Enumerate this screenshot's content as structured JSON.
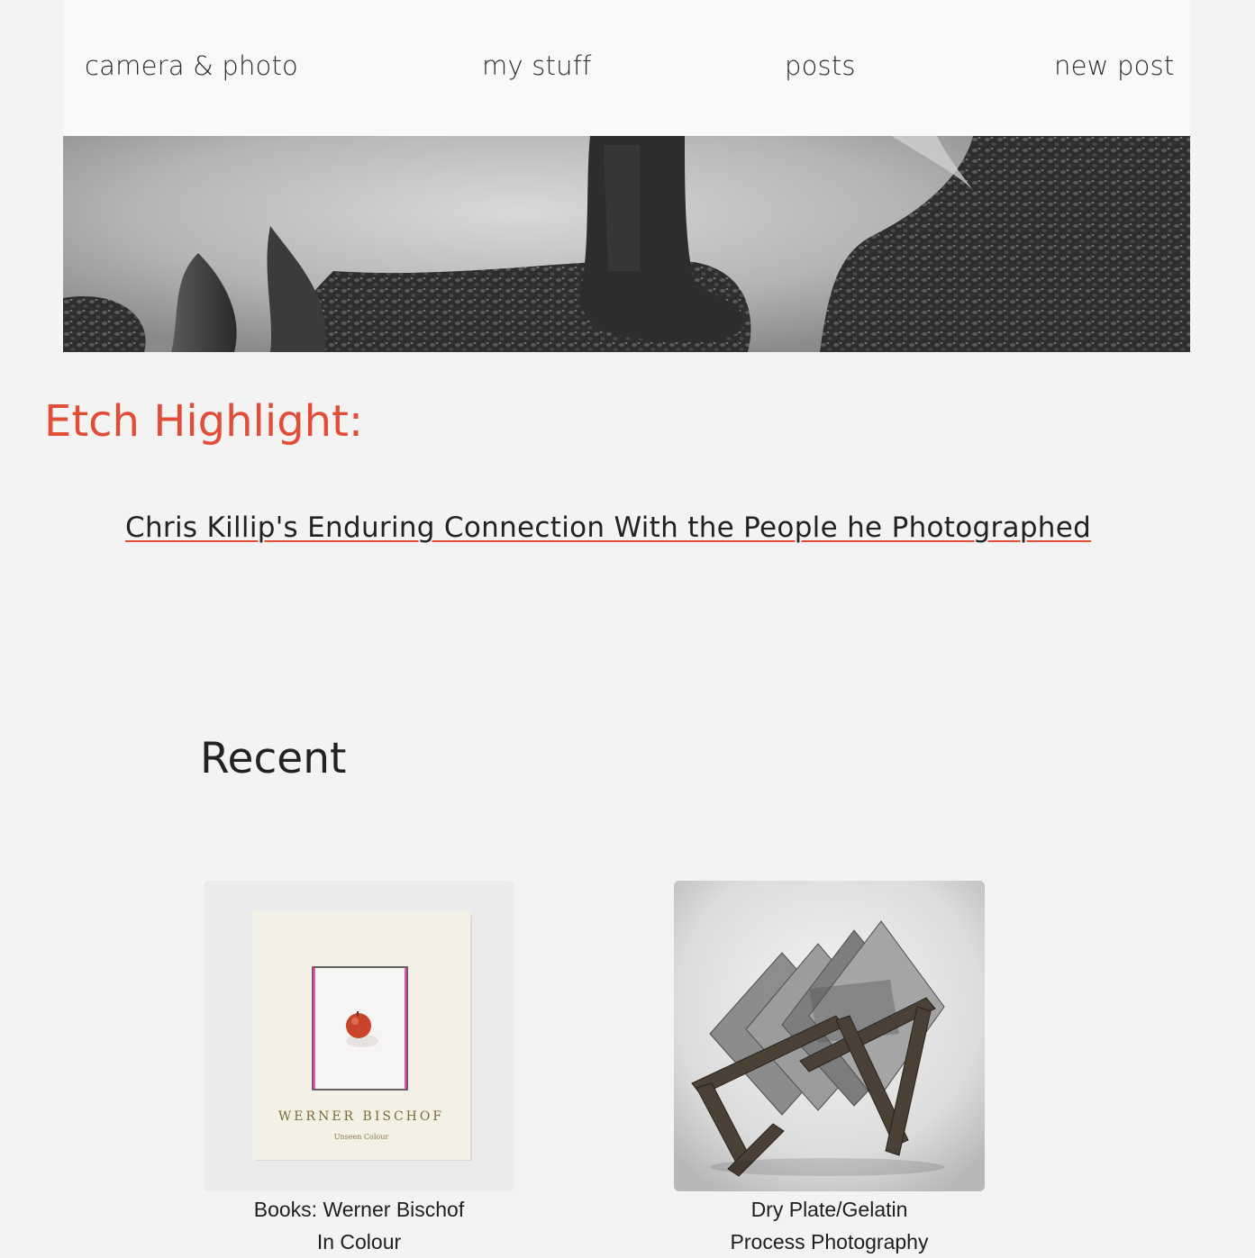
{
  "nav": {
    "items": [
      "camera & photo",
      "my stuff",
      "posts",
      "new post"
    ]
  },
  "highlight": {
    "title": "Etch Highlight:",
    "link": "Chris Killip's Enduring Connection With the People he Photographed"
  },
  "recent": {
    "title": "Recent",
    "cards": [
      {
        "caption_line1": "Books: Werner Bischof",
        "caption_line2": "In Colour",
        "book_author": "WERNER BISCHOF",
        "book_subtitle": "Unseen Colour"
      },
      {
        "caption_line1": "Dry Plate/Gelatin",
        "caption_line2": "Process Photography"
      }
    ]
  },
  "colors": {
    "accent": "#e24d38",
    "background": "#f3f3f3",
    "nav_bg": "#f8f9fa"
  }
}
